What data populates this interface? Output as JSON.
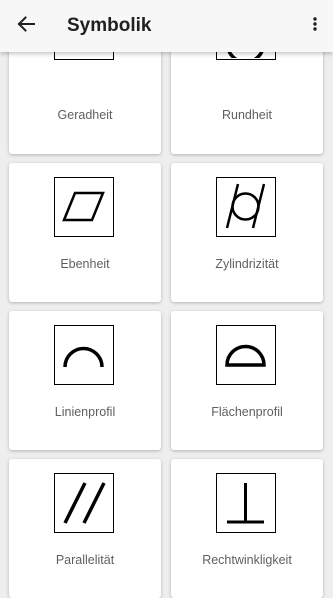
{
  "app_bar": {
    "title": "Symbolik",
    "back_icon": "arrow-back-icon",
    "menu_icon": "more-vert-icon"
  },
  "symbols": [
    {
      "label": "Geradheit",
      "icon": "straightness-icon"
    },
    {
      "label": "Rundheit",
      "icon": "circularity-icon"
    },
    {
      "label": "Ebenheit",
      "icon": "flatness-icon"
    },
    {
      "label": "Zylindrizität",
      "icon": "cylindricity-icon"
    },
    {
      "label": "Linienprofil",
      "icon": "line-profile-icon"
    },
    {
      "label": "Flächenprofil",
      "icon": "surface-profile-icon"
    },
    {
      "label": "Parallelität",
      "icon": "parallelism-icon"
    },
    {
      "label": "Rechtwinkligkeit",
      "icon": "perpendicularity-icon"
    }
  ]
}
